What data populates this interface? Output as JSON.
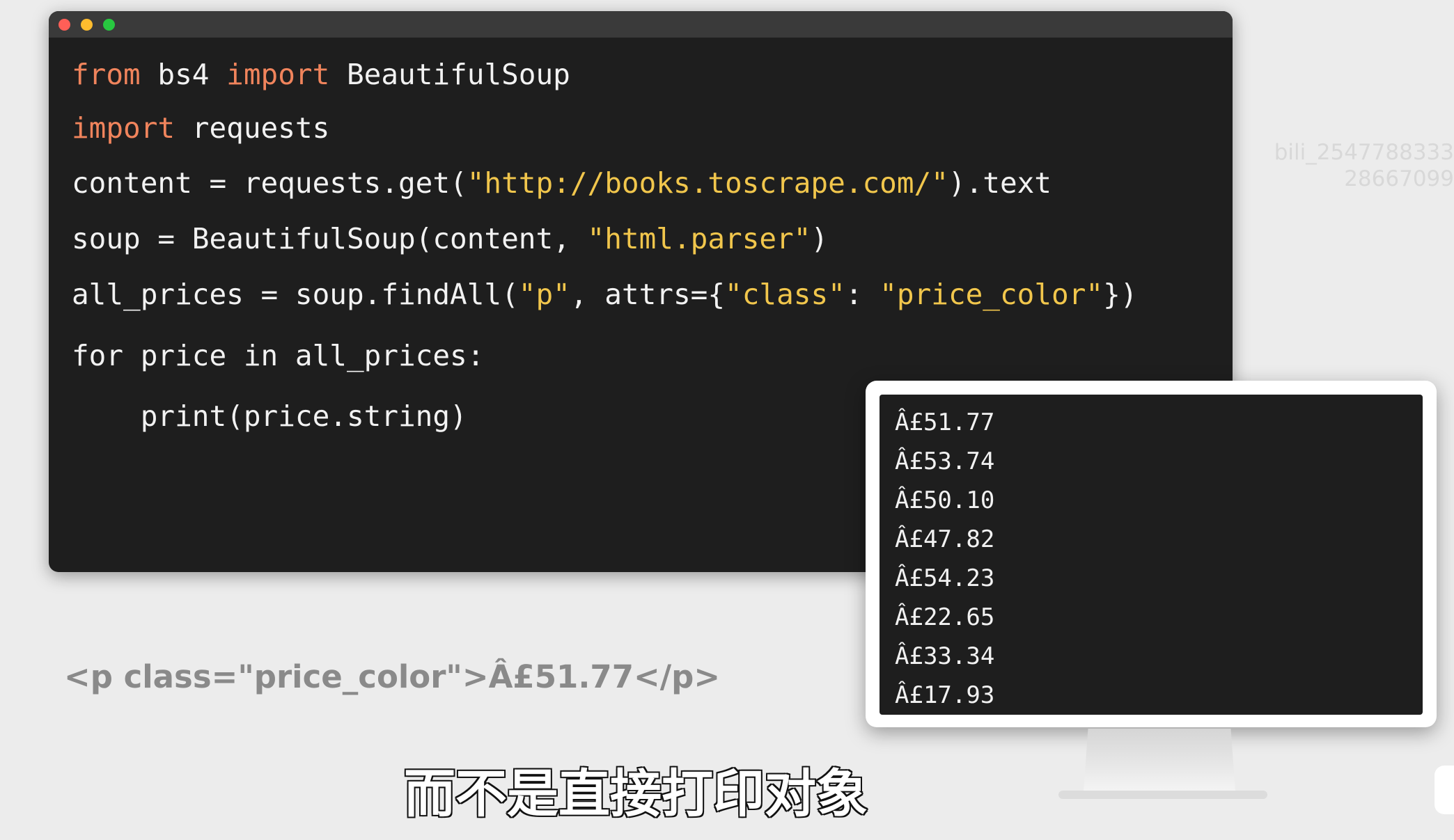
{
  "editor": {
    "lines": [
      [
        {
          "t": "from",
          "k": "kw"
        },
        {
          "t": " bs4 "
        },
        {
          "t": "import",
          "k": "kw"
        },
        {
          "t": " BeautifulSoup"
        }
      ],
      [
        {
          "t": "import",
          "k": "kw"
        },
        {
          "t": " requests"
        }
      ],
      [
        {
          "t": "content = requests.get("
        },
        {
          "t": "\"http://books.toscrape.com/\"",
          "k": "str"
        },
        {
          "t": ").text"
        }
      ],
      [
        {
          "t": "soup = BeautifulSoup(content, "
        },
        {
          "t": "\"html.parser\"",
          "k": "str"
        },
        {
          "t": ")"
        }
      ],
      [
        {
          "t": "all_prices = soup.findAll("
        },
        {
          "t": "\"p\"",
          "k": "str"
        },
        {
          "t": ", attrs={"
        },
        {
          "t": "\"class\"",
          "k": "str"
        },
        {
          "t": ": "
        },
        {
          "t": "\"price_color\"",
          "k": "str"
        },
        {
          "t": "})"
        }
      ],
      [
        {
          "t": "for price in all_prices:"
        }
      ],
      [
        {
          "t": "    print(price.string)"
        }
      ]
    ]
  },
  "output": {
    "prices": [
      "Â£51.77",
      "Â£53.74",
      "Â£50.10",
      "Â£47.82",
      "Â£54.23",
      "Â£22.65",
      "Â£33.34",
      "Â£17.93"
    ]
  },
  "snippet": "<p class=\"price_color\">Â£51.77</p>",
  "subtitle": "而不是直接打印对象",
  "watermark": {
    "line1": "bili_2547788333",
    "line2": "28667099"
  },
  "colors": {
    "keyword": "#f0845c",
    "string": "#f1c64c",
    "text": "#f2f2f2",
    "editor_bg": "#1e1e1e",
    "light_red": "#ff5f57",
    "light_yellow": "#febc2e",
    "light_green": "#28c840"
  }
}
